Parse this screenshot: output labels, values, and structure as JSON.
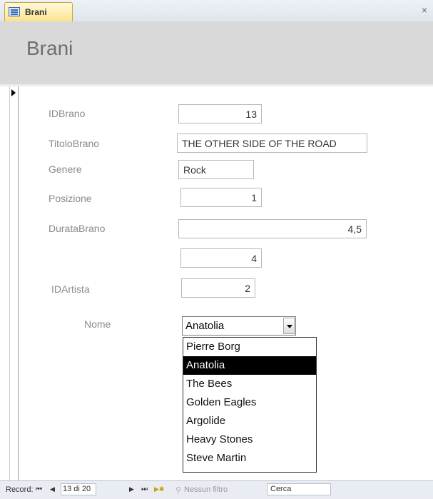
{
  "tab": {
    "label": "Brani",
    "close": "×"
  },
  "form": {
    "title": "Brani"
  },
  "fields": {
    "idbrano": {
      "label": "IDBrano",
      "value": "13"
    },
    "titolobrano": {
      "label": "TitoloBrano",
      "value": "THE OTHER SIDE OF THE ROAD"
    },
    "genere": {
      "label": "Genere",
      "value": "Rock"
    },
    "posizione": {
      "label": "Posizione",
      "value": "1"
    },
    "duratabrano": {
      "label": "DurataBrano",
      "value": "4,5"
    },
    "unlabeled": {
      "value": "4"
    },
    "idartista": {
      "label": "IDArtista",
      "value": "2"
    },
    "nome": {
      "label": "Nome",
      "value": "Anatolia"
    }
  },
  "dropdown": {
    "options": [
      "Pierre Borg",
      "Anatolia",
      "The Bees",
      "Golden Eagles",
      "Argolide",
      "Heavy Stones",
      "Steve Martin"
    ],
    "selected": "Anatolia"
  },
  "statusbar": {
    "record_label": "Record:",
    "first": "⏮",
    "prev": "◀",
    "position": "13 di 20",
    "next": "▶",
    "last": "⏭",
    "new": "▶✱",
    "filter": "Nessun filtro",
    "search": "Cerca"
  }
}
